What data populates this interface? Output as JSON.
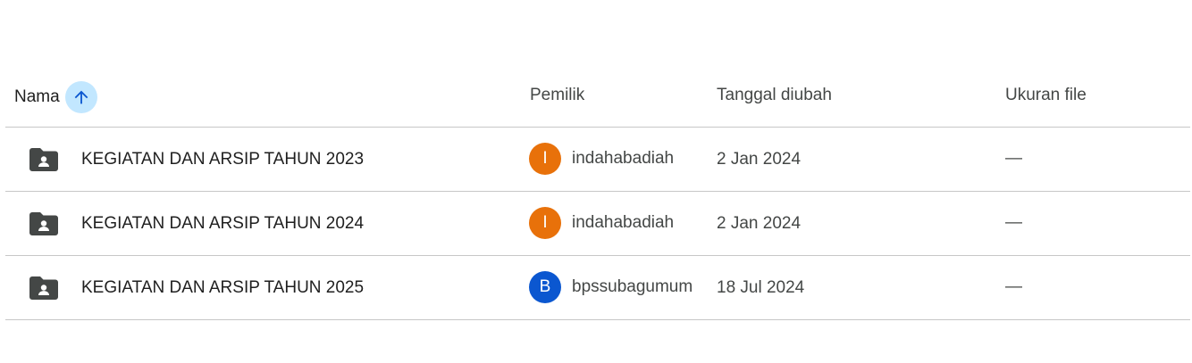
{
  "header": {
    "name_label": "Nama",
    "sort_icon": "arrow-upward-icon",
    "owner_label": "Pemilik",
    "date_label": "Tanggal diubah",
    "size_label": "Ukuran file"
  },
  "colors": {
    "sort_button_bg": "#c2e7ff",
    "sort_arrow": "#0b57d0",
    "folder_icon": "#444746",
    "divider": "#c7c7c7"
  },
  "files": [
    {
      "icon": "shared-folder-icon",
      "name": "KEGIATAN DAN ARSIP TAHUN 2023",
      "owner_initial": "I",
      "owner_color": "#e8710a",
      "owner": "indahabadiah",
      "modified": "2 Jan 2024",
      "size": "—"
    },
    {
      "icon": "shared-folder-icon",
      "name": "KEGIATAN DAN ARSIP TAHUN 2024",
      "owner_initial": "I",
      "owner_color": "#e8710a",
      "owner": "indahabadiah",
      "modified": "2 Jan 2024",
      "size": "—"
    },
    {
      "icon": "shared-folder-icon",
      "name": "KEGIATAN DAN ARSIP TAHUN 2025",
      "owner_initial": "B",
      "owner_color": "#0b57d0",
      "owner": "bpssubagumum",
      "modified": "18 Jul 2024",
      "size": "—"
    }
  ]
}
